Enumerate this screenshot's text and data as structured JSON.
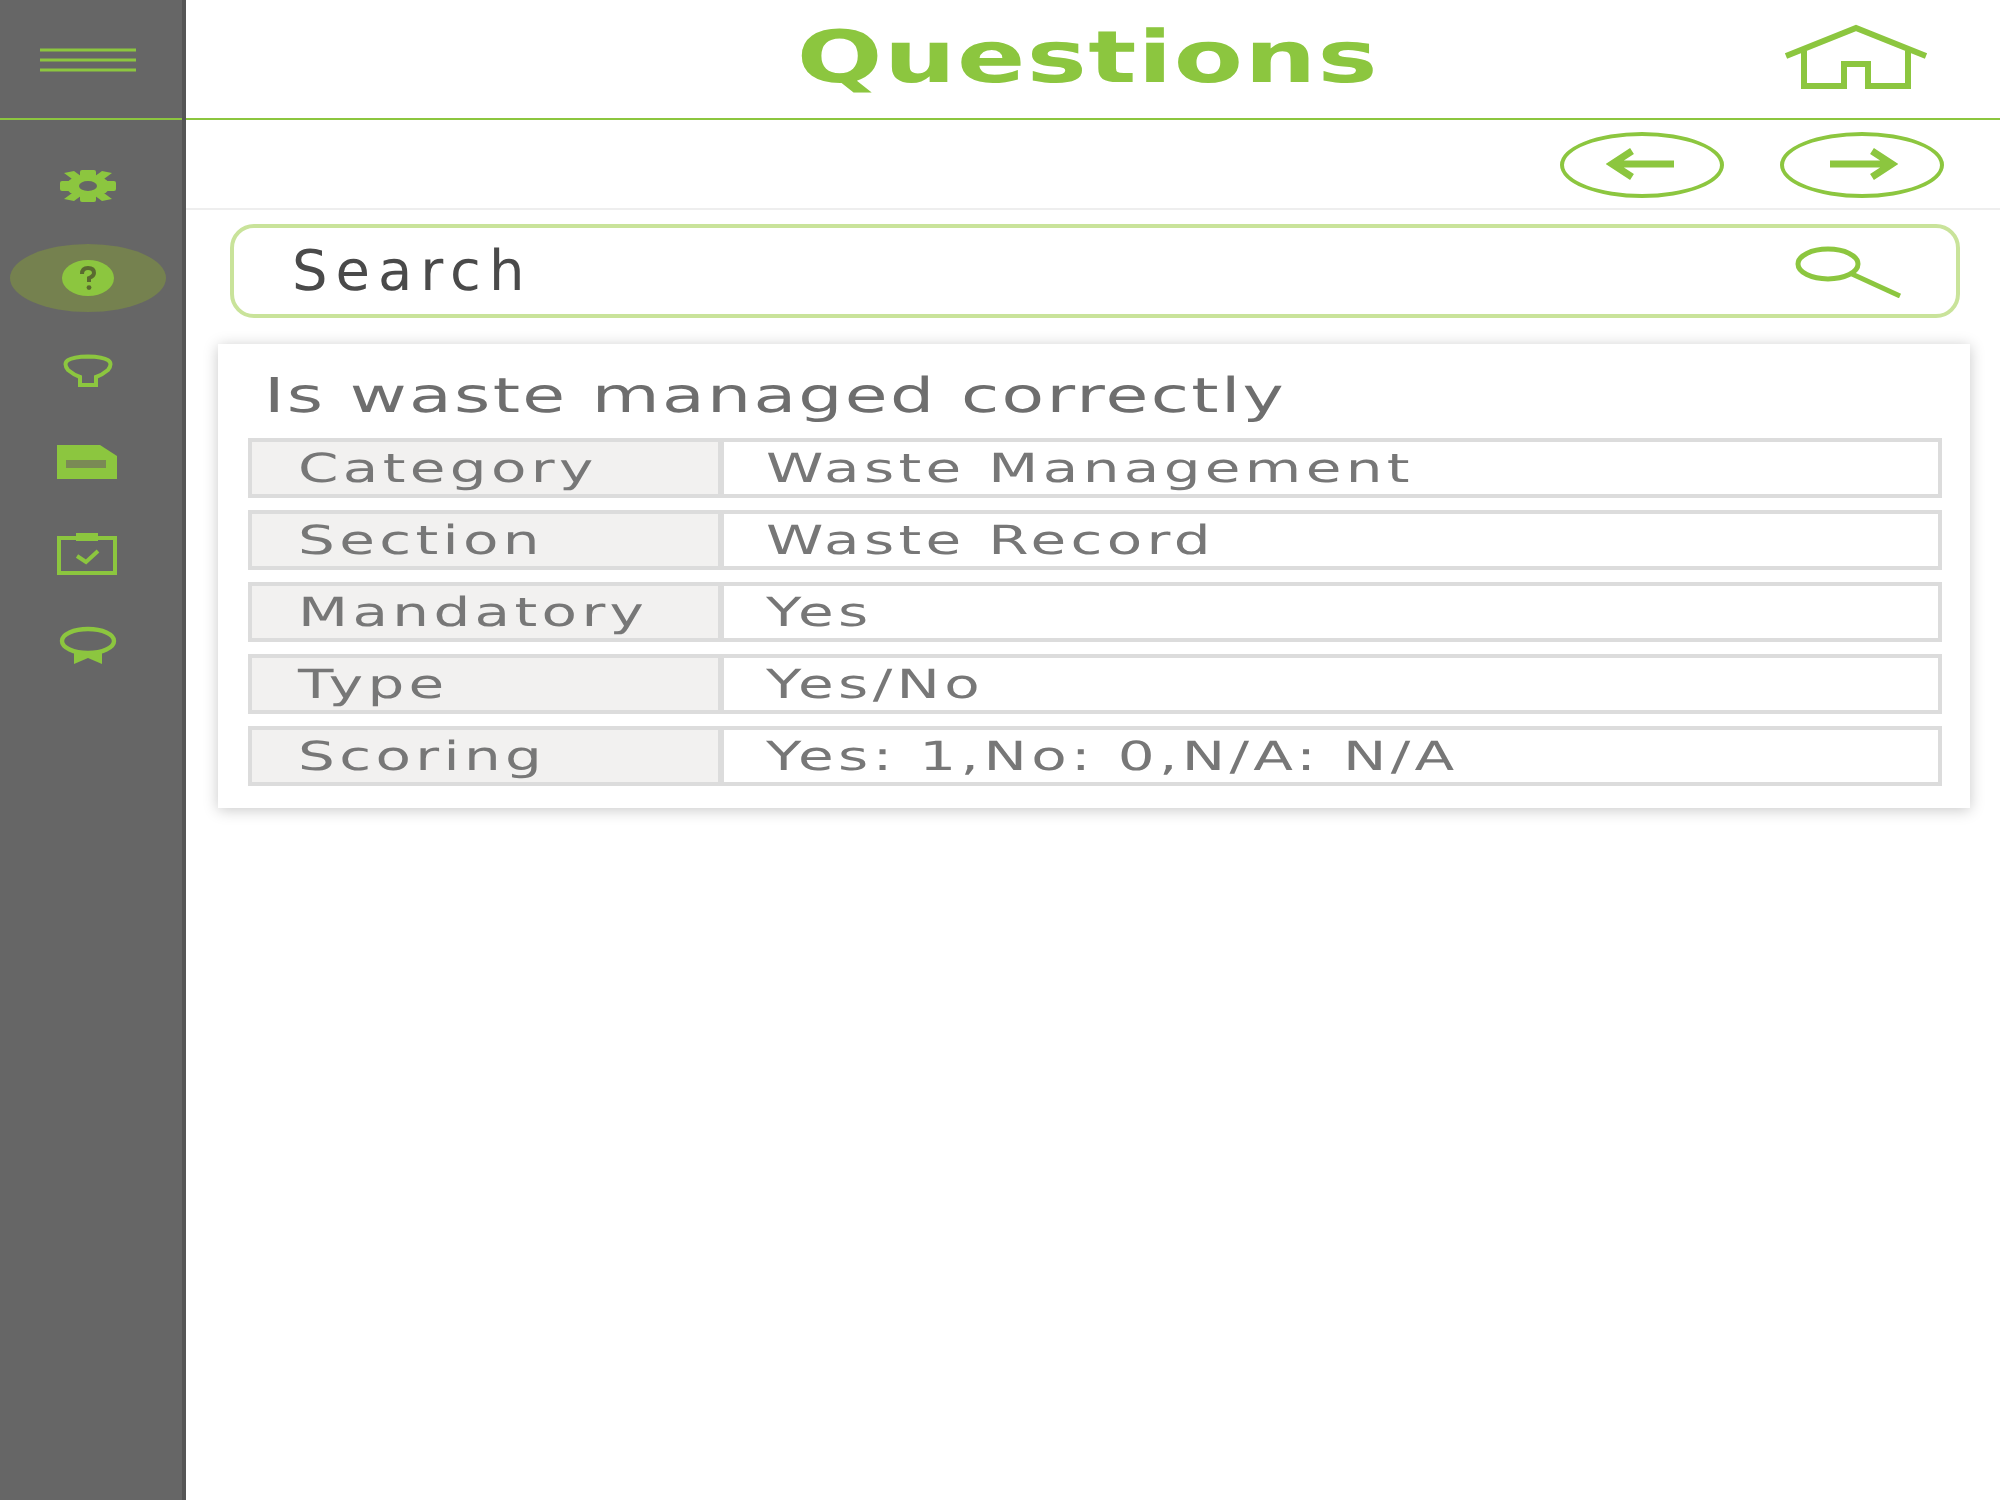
{
  "sidebar": {
    "items": [
      {
        "selected": false
      },
      {
        "selected": true
      },
      {
        "selected": false
      },
      {
        "selected": false
      },
      {
        "selected": false
      },
      {
        "selected": false
      }
    ]
  },
  "header": {
    "title": "Questions"
  },
  "search": {
    "placeholder": "Search"
  },
  "question": {
    "title": "Is waste managed correctly",
    "fields": [
      {
        "label": "Category",
        "value": "Waste Management"
      },
      {
        "label": "Section",
        "value": "Waste Record"
      },
      {
        "label": "Mandatory",
        "value": "Yes"
      },
      {
        "label": "Type",
        "value": "Yes/No"
      },
      {
        "label": "Scoring",
        "value": "Yes: 1,No: 0,N/A: N/A"
      }
    ]
  }
}
